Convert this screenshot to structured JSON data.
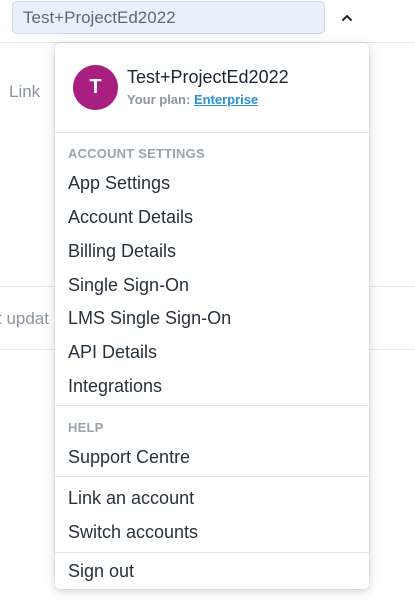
{
  "account_selector": {
    "value": "Test+ProjectEd2022"
  },
  "background": {
    "link_text": "Link",
    "updated_text": "t updat"
  },
  "dropdown": {
    "profile": {
      "initial": "T",
      "name": "Test+ProjectEd2022",
      "plan_label": "Your plan:",
      "plan_value": "Enterprise"
    },
    "account_settings": {
      "header": "ACCOUNT SETTINGS",
      "items": [
        "App Settings",
        "Account Details",
        "Billing Details",
        "Single Sign-On",
        "LMS Single Sign-On",
        "API Details",
        "Integrations"
      ]
    },
    "help": {
      "header": "HELP",
      "items": [
        "Support Centre"
      ]
    },
    "accounts": {
      "items": [
        "Link an account",
        "Switch accounts"
      ]
    },
    "sign_out": "Sign out"
  },
  "colors": {
    "avatar": "#a81f80",
    "link": "#2d8fd6",
    "select_bg": "#e8f1fb"
  },
  "icons": {
    "caret": "chevron-up-icon"
  }
}
